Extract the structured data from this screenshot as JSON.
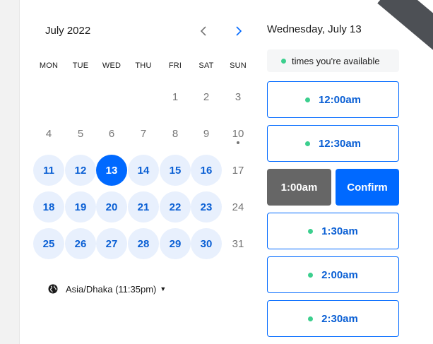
{
  "calendar": {
    "month_label": "July 2022",
    "weekdays": [
      "MON",
      "TUE",
      "WED",
      "THU",
      "FRI",
      "SAT",
      "SUN"
    ],
    "week1": [
      "1",
      "2",
      "3"
    ],
    "week2": [
      "4",
      "5",
      "6",
      "7",
      "8",
      "9",
      "10"
    ],
    "week3": [
      "11",
      "12",
      "13",
      "14",
      "15",
      "16",
      "17"
    ],
    "week4": [
      "18",
      "19",
      "20",
      "21",
      "22",
      "23",
      "24"
    ],
    "week5": [
      "25",
      "26",
      "27",
      "28",
      "29",
      "30",
      "31"
    ],
    "selected_day": "13",
    "timezone": "Asia/Dhaka (11:35pm)"
  },
  "schedule": {
    "date_heading": "Wednesday, July 13",
    "legend": "times you're available",
    "slots": [
      "12:00am",
      "12:30am",
      "1:00am",
      "1:30am",
      "2:00am",
      "2:30am"
    ],
    "confirm_label": "Confirm"
  },
  "colors": {
    "accent": "#0069ff",
    "available_bg": "#e8f0fd",
    "available_dot": "#3ccf8e",
    "chosen_slot_bg": "#666666"
  },
  "icons": {
    "prev": "chevron-left-icon",
    "next": "chevron-right-icon",
    "timezone": "globe-icon",
    "dropdown": "caret-down-icon"
  }
}
